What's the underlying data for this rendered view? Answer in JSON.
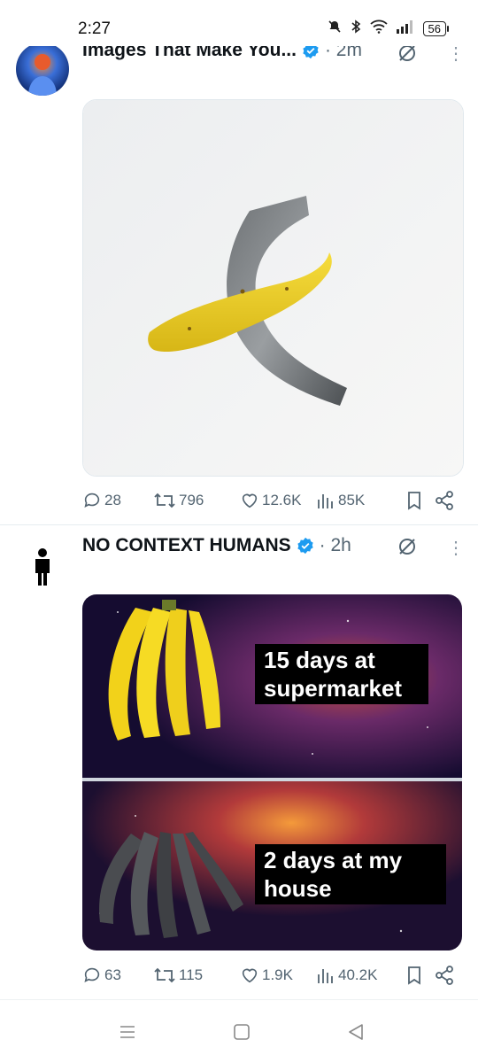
{
  "status": {
    "time": "2:27",
    "battery": "56"
  },
  "posts": [
    {
      "author": "Images That Make You...",
      "time": "· 2m",
      "stats": {
        "replies": "28",
        "reposts": "796",
        "likes": "12.6K",
        "views": "85K"
      }
    },
    {
      "author": "NO CONTEXT HUMANS",
      "time": "· 2h",
      "meme": {
        "top_text": "15 days at supermarket",
        "bottom_text": "2 days at my house"
      },
      "stats": {
        "replies": "63",
        "reposts": "115",
        "likes": "1.9K",
        "views": "40.2K"
      }
    }
  ],
  "colors": {
    "verified": "#1d9bf0",
    "muted": "#536471",
    "text": "#0f1419"
  }
}
